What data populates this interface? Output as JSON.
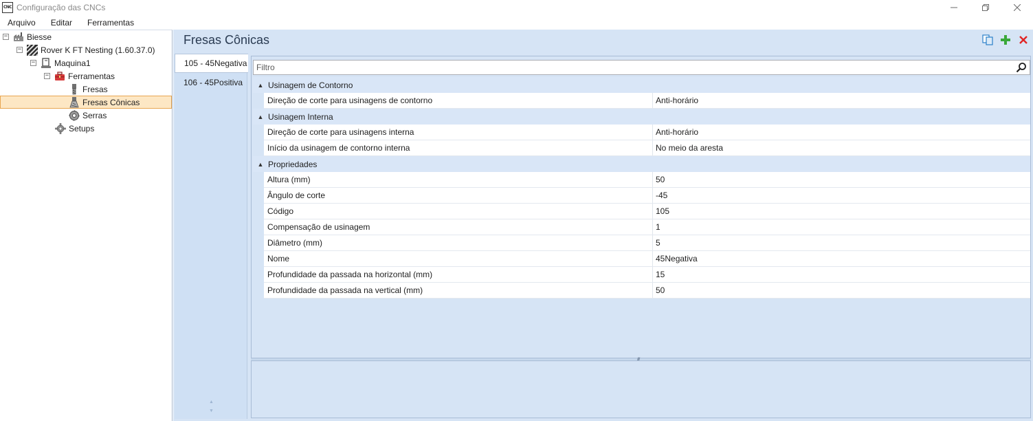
{
  "window": {
    "title": "Configuração das CNCs",
    "app_icon_text": "CNC",
    "controls": [
      "minimize",
      "restore",
      "close"
    ]
  },
  "menu": [
    "Arquivo",
    "Editar",
    "Ferramentas"
  ],
  "tree": {
    "items": [
      {
        "label": "Biesse",
        "icon": "factory-icon",
        "expander": "⊟"
      },
      {
        "label": "Rover K FT Nesting (1.60.37.0)",
        "icon": "machine-stripes-icon",
        "expander": "⊟"
      },
      {
        "label": "Maquina1",
        "icon": "machine-icon",
        "expander": "⊟"
      },
      {
        "label": "Ferramentas",
        "icon": "toolbox-icon",
        "expander": "⊟"
      },
      {
        "label": "Fresas",
        "icon": "drill-bit-icon"
      },
      {
        "label": "Fresas Cônicas",
        "icon": "conical-bit-icon",
        "selected": true
      },
      {
        "label": "Serras",
        "icon": "saw-blade-icon"
      },
      {
        "label": "Setups",
        "icon": "gear-icon"
      }
    ]
  },
  "page": {
    "title": "Fresas Cônicas",
    "actions": [
      "copy-icon",
      "add-icon",
      "delete-icon"
    ]
  },
  "tools": [
    {
      "label": "105 - 45Negativa",
      "active": true
    },
    {
      "label": "106 - 45Positiva",
      "active": false
    }
  ],
  "filter": {
    "placeholder": "Filtro",
    "value": ""
  },
  "categories": [
    {
      "label": "Usinagem de Contorno",
      "rows": [
        {
          "name": "Direção de corte para usinagens de contorno",
          "value": "Anti-horário"
        }
      ]
    },
    {
      "label": "Usinagem Interna",
      "rows": [
        {
          "name": "Direção de corte para usinagens interna",
          "value": "Anti-horário"
        },
        {
          "name": "Início da usinagem de contorno interna",
          "value": "No meio da aresta"
        }
      ]
    },
    {
      "label": "Propriedades",
      "rows": [
        {
          "name": "Altura (mm)",
          "value": "50"
        },
        {
          "name": "Ângulo de corte",
          "value": "-45"
        },
        {
          "name": "Código",
          "value": "105"
        },
        {
          "name": "Compensação de usinagem",
          "value": "1"
        },
        {
          "name": "Diâmetro (mm)",
          "value": "5"
        },
        {
          "name": "Nome",
          "value": "45Negativa"
        },
        {
          "name": "Profundidade da passada na horizontal (mm)",
          "value": "15"
        },
        {
          "name": "Profundidade da passada na vertical (mm)",
          "value": "50"
        }
      ]
    }
  ],
  "colors": {
    "panel_bg": "#d6e4f5",
    "selection_bg": "#fde7c4",
    "selection_border": "#e8a651",
    "add_green": "#3aa83a",
    "delete_red": "#e02424"
  }
}
